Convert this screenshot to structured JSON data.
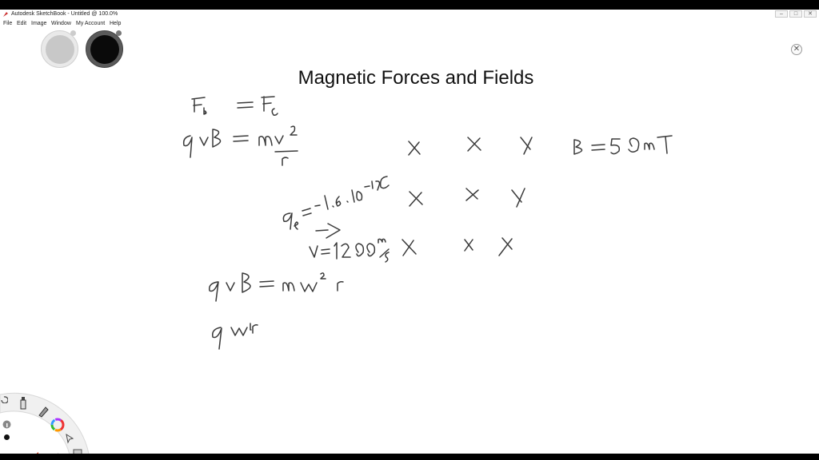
{
  "window": {
    "title": "Autodesk SketchBook - Untitled @ 100.0%",
    "minimize_glyph": "–",
    "maximize_glyph": "□",
    "close_glyph": "✕"
  },
  "menu": [
    "File",
    "Edit",
    "Image",
    "Window",
    "My Account",
    "Help"
  ],
  "brush_colors": {
    "primary": "#c8c8c8",
    "secondary": "#0a0a0a"
  },
  "canvas": {
    "heading": "Magnetic Forces and Fields",
    "close_glyph": "✕"
  },
  "icons": {
    "app": "sketchbook-icon",
    "lagoon": [
      "rotate-icon",
      "brush-icon",
      "marker-icon",
      "color-wheel-icon",
      "select-icon",
      "undo-icon",
      "redo-icon",
      "layer-icon",
      "info-icon",
      "dot-icon"
    ]
  },
  "handwriting": [
    "F_B = F_c",
    "qvB = m v^2 / r",
    "X X X B = 5 0 mT",
    "q_e = -1.6·10^-19 C",
    "X X X",
    "->",
    "v = 1200 m/s X X X",
    "qvB = m w^2 r",
    "q w r"
  ]
}
